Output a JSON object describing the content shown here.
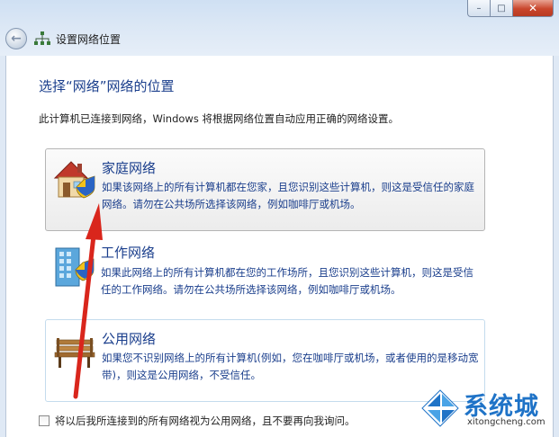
{
  "window": {
    "title": "设置网络位置",
    "minimize": "–",
    "maximize": "□",
    "close": "✕"
  },
  "page": {
    "heading": "选择“网络”网络的位置",
    "description": "此计算机已连接到网络，Windows 将根据网络位置自动应用正确的网络设置。"
  },
  "options": [
    {
      "title": "家庭网络",
      "text": "如果该网络上的所有计算机都在您家，且您识别这些计算机，则这是受信任的家庭网络。请勿在公共场所选择该网络，例如咖啡厅或机场。",
      "icon": "home-network-icon"
    },
    {
      "title": "工作网络",
      "text": "如果此网络上的所有计算机都在您的工作场所，且您识别这些计算机，则这是受信任的工作网络。请勿在公共场所选择该网络，例如咖啡厅或机场。",
      "icon": "work-network-icon"
    },
    {
      "title": "公用网络",
      "text": "如果您不识别网络上的所有计算机(例如，您在咖啡厅或机场，或者使用的是移动宽带)，则这是公用网络，不受信任。",
      "icon": "public-network-icon"
    }
  ],
  "checkbox": {
    "label": "将以后我所连接到的所有网络视为公用网络，且不要再向我询问。",
    "checked": false
  },
  "watermark": {
    "text": "系统城",
    "url": "xitongcheng.com"
  },
  "colors": {
    "accent": "#1a3e8c",
    "arrow": "#d9261c",
    "watermark": "#1f73c7"
  }
}
